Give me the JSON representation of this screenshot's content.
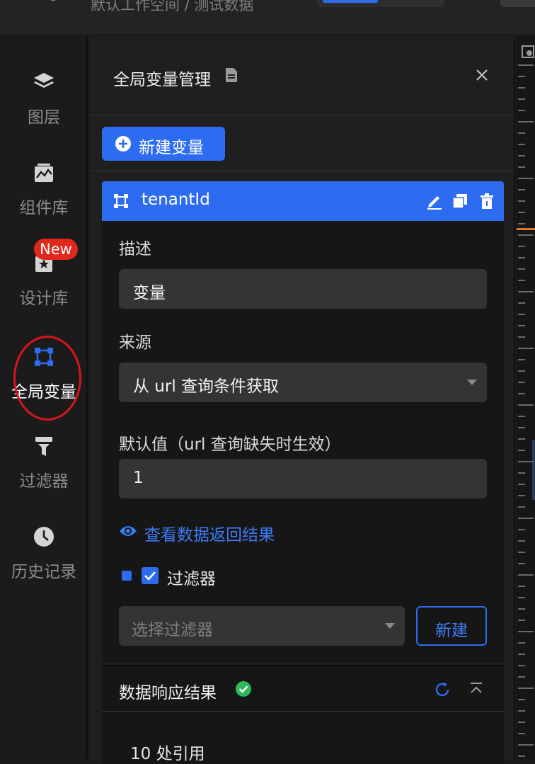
{
  "topbar": {
    "breadcrumb": "默认工作空间 / 测试数据"
  },
  "sidebar": {
    "items": [
      {
        "label": "图层",
        "icon": "layers-icon"
      },
      {
        "label": "组件库",
        "icon": "chart-library-icon"
      },
      {
        "label": "设计库",
        "icon": "design-library-icon"
      },
      {
        "label": "全局变量",
        "icon": "global-variable-icon",
        "active": true
      },
      {
        "label": "过滤器",
        "icon": "filter-icon"
      },
      {
        "label": "历史记录",
        "icon": "history-clock-icon"
      }
    ],
    "new_badge": "New"
  },
  "panel": {
    "title": "全局变量管理",
    "new_variable_label": "新建变量",
    "variable": {
      "name": "tenantId",
      "description_label": "描述",
      "description_value": "变量",
      "source_label": "来源",
      "source_value": "从 url 查询条件获取",
      "default_label": "默认值（url 查询缺失时生效）",
      "default_value": "1",
      "view_result_link": "查看数据返回结果",
      "filter_label": "过滤器",
      "filter_checked": true,
      "filter_placeholder": "选择过滤器",
      "filter_new_label": "新建"
    },
    "response": {
      "title": "数据响应结果",
      "count_text": "10 处引用"
    }
  },
  "colors": {
    "accent": "#2d6cf0",
    "danger": "#e0281d",
    "success": "#2eb85c",
    "ruler_marker": "#e07b2a"
  }
}
